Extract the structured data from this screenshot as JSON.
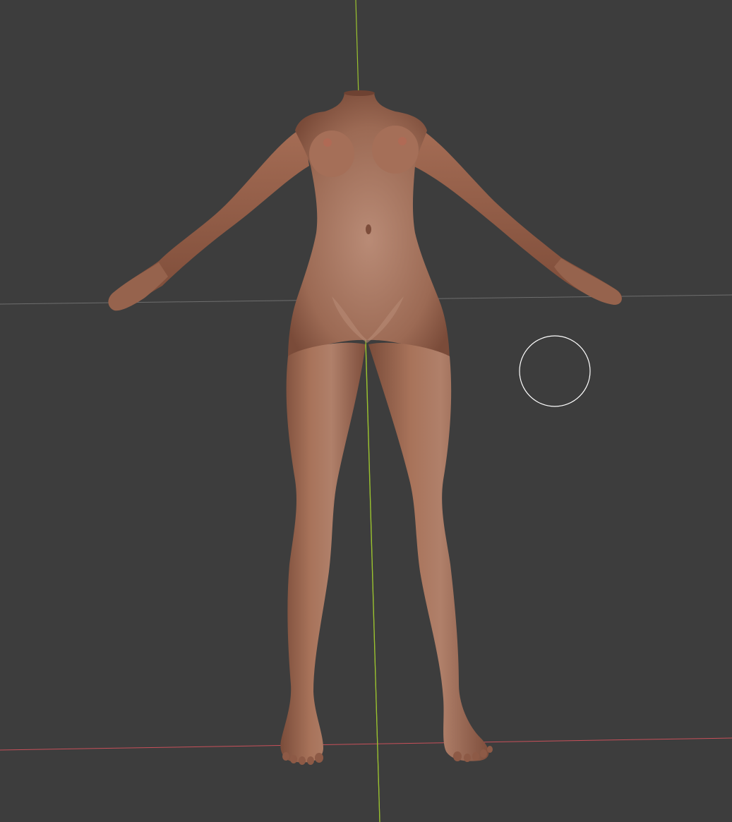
{
  "viewport": {
    "background": "#3d3d3d",
    "axes": {
      "x_axis_color": "#c8505a",
      "y_axis_color": "#9bc32f",
      "grid_line_color": "#6e6e6e"
    },
    "mesh": {
      "object": "body-mesh",
      "skin_color": "#a06a52",
      "shading": "smooth"
    },
    "cursor": {
      "shape": "brush-circle",
      "color": "#ffffff"
    }
  }
}
